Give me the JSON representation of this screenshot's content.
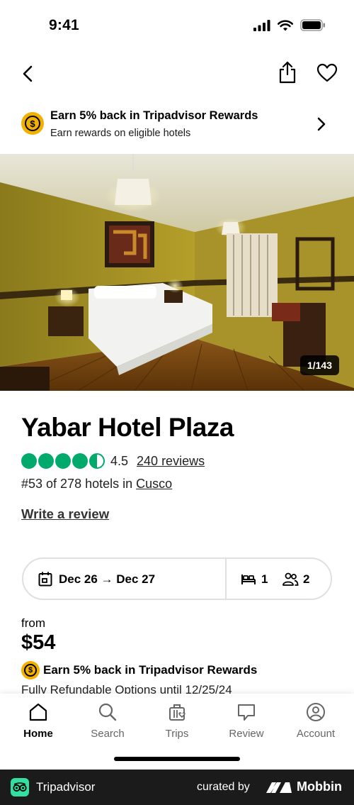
{
  "status_bar": {
    "time": "9:41"
  },
  "rewards_banner": {
    "coin_symbol": "$",
    "title": "Earn 5% back in Tripadvisor Rewards",
    "subtitle": "Earn rewards on eligible hotels"
  },
  "gallery": {
    "counter": "1/143",
    "current": 1,
    "total": 143
  },
  "hotel": {
    "name": "Yabar Hotel Plaza",
    "rating_value": "4.5",
    "rating_bubbles": 4.5,
    "reviews_label": "240 reviews",
    "ranking_prefix": "#53 of 278 hotels in ",
    "city": "Cusco",
    "write_review_label": "Write a review"
  },
  "booking": {
    "dates": "Dec 26 → Dec 27",
    "rooms": "1",
    "guests": "2"
  },
  "pricing": {
    "from_label": "from",
    "price": "$54",
    "coin_symbol": "$",
    "rewards_text": "Earn 5% back in Tripadvisor Rewards",
    "refund_text": "Fully Refundable Options until 12/25/24"
  },
  "tab_bar": {
    "tabs": [
      {
        "label": "Home",
        "icon": "home-icon",
        "active": true
      },
      {
        "label": "Search",
        "icon": "search-icon",
        "active": false
      },
      {
        "label": "Trips",
        "icon": "suitcase-icon",
        "active": false
      },
      {
        "label": "Review",
        "icon": "speech-bubble-icon",
        "active": false
      },
      {
        "label": "Account",
        "icon": "account-icon",
        "active": false
      }
    ]
  },
  "footer": {
    "brand": "Tripadvisor",
    "curated_by": "curated by",
    "curator": "Mobbin"
  },
  "colors": {
    "rating_green": "#00aa6c",
    "coin_gold": "#f2b100",
    "footer_bg": "#1b1b1b",
    "tripadvisor_mint": "#34e0a1"
  }
}
